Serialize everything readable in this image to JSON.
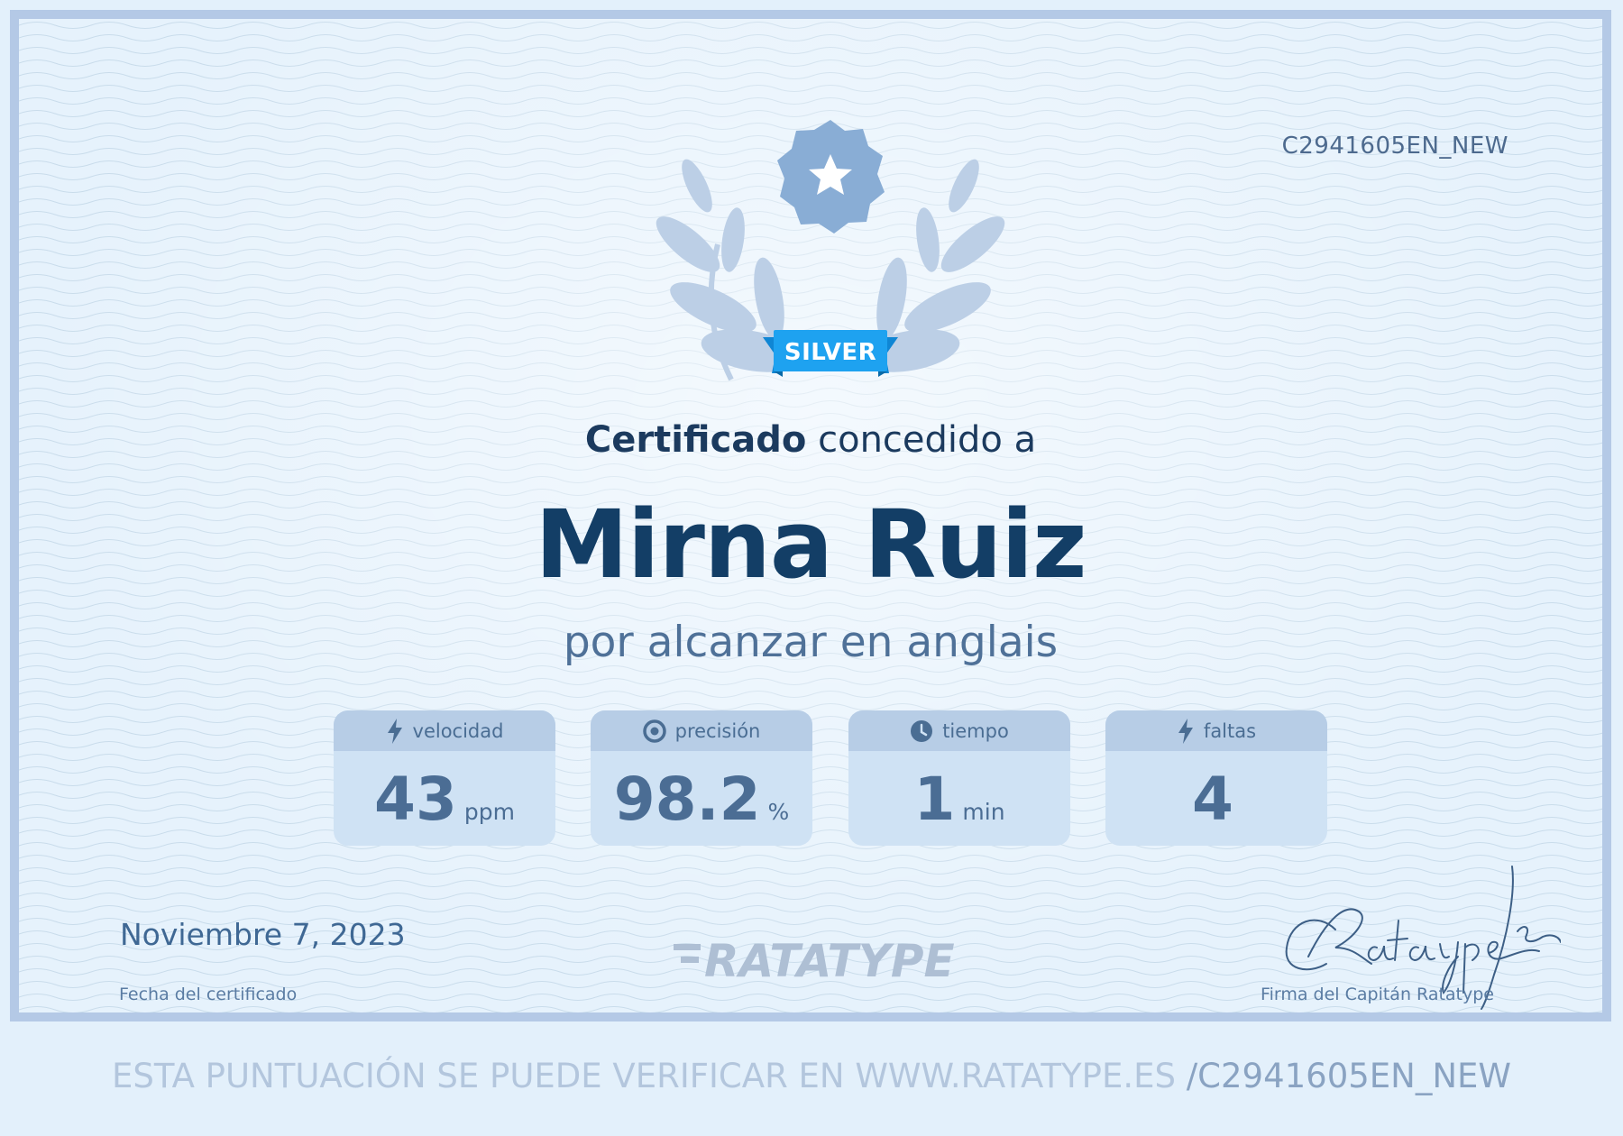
{
  "certificate_id": "C2941605EN_NEW",
  "badge": {
    "label": "SILVER"
  },
  "headline": {
    "bold": "Certificado",
    "rest": " concedido a"
  },
  "recipient": "Mirna Ruiz",
  "subline": "por alcanzar en anglais",
  "stats": [
    {
      "icon": "lightning-icon",
      "label": "velocidad",
      "value": "43",
      "unit": "ppm"
    },
    {
      "icon": "target-icon",
      "label": "precisión",
      "value": "98.2",
      "unit": "%"
    },
    {
      "icon": "clock-icon",
      "label": "tiempo",
      "value": "1",
      "unit": "min"
    },
    {
      "icon": "lightning-icon",
      "label": "faltas",
      "value": "4",
      "unit": ""
    }
  ],
  "footer": {
    "date": "Noviembre 7, 2023",
    "date_caption": "Fecha del certificado",
    "brand": "RATATYPE",
    "signature": "CRatatype",
    "signature_caption": "Firma del Capitán Ratatype"
  },
  "verify": {
    "prefix": "ESTA PUNTUACIÓN SE PUEDE VERIFICAR EN WWW.RATATYPE.ES",
    "code": "/C2941605EN_NEW"
  },
  "colors": {
    "border": "#b4c9e6",
    "ribbon": "#1ea2f0",
    "name": "#133e66",
    "stat_header": "#b7cde6",
    "stat_body": "#cfe2f4"
  }
}
